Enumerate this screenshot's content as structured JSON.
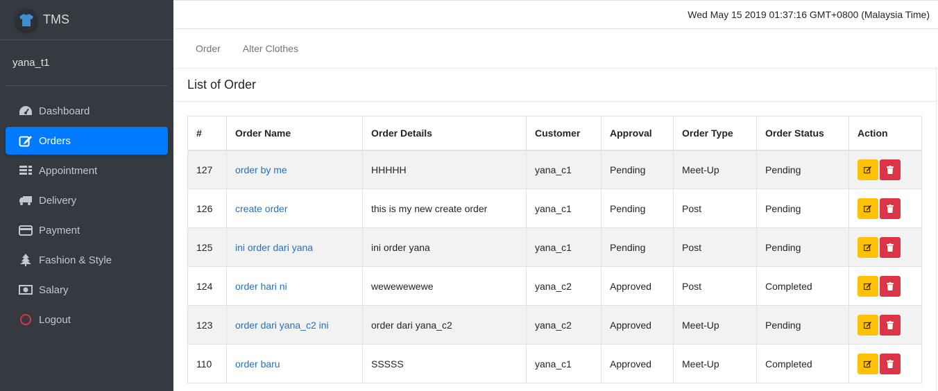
{
  "app": {
    "brand": "TMS",
    "user": "yana_t1"
  },
  "sidebar": {
    "items": [
      {
        "label": "Dashboard",
        "icon": "dashboard-icon",
        "active": false
      },
      {
        "label": "Orders",
        "icon": "edit-icon",
        "active": true
      },
      {
        "label": "Appointment",
        "icon": "appointment-icon",
        "active": false
      },
      {
        "label": "Delivery",
        "icon": "truck-icon",
        "active": false
      },
      {
        "label": "Payment",
        "icon": "credit-card-icon",
        "active": false
      },
      {
        "label": "Fashion & Style",
        "icon": "tree-icon",
        "active": false
      },
      {
        "label": "Salary",
        "icon": "money-icon",
        "active": false
      },
      {
        "label": "Logout",
        "icon": "logout-icon",
        "active": false
      }
    ]
  },
  "topbar": {
    "datetime": "Wed May 15 2019 01:37:16 GMT+0800 (Malaysia Time)"
  },
  "tabs": [
    "Order",
    "Alter Clothes"
  ],
  "card": {
    "title": "List of Order"
  },
  "table": {
    "headers": [
      "#",
      "Order Name",
      "Order Details",
      "Customer",
      "Approval",
      "Order Type",
      "Order Status",
      "Action"
    ],
    "rows": [
      {
        "id": "127",
        "name": "order by me",
        "details": "HHHHH",
        "customer": "yana_c1",
        "approval": "Pending",
        "type": "Meet-Up",
        "status": "Pending"
      },
      {
        "id": "126",
        "name": "create order",
        "details": "this is my new create order",
        "customer": "yana_c1",
        "approval": "Pending",
        "type": "Post",
        "status": "Pending"
      },
      {
        "id": "125",
        "name": "ini order dari yana",
        "details": "ini order yana",
        "customer": "yana_c1",
        "approval": "Pending",
        "type": "Post",
        "status": "Pending"
      },
      {
        "id": "124",
        "name": "order hari ni",
        "details": "wewewewewe",
        "customer": "yana_c2",
        "approval": "Approved",
        "type": "Post",
        "status": "Completed"
      },
      {
        "id": "123",
        "name": "order dari yana_c2 ini",
        "details": "order dari yana_c2",
        "customer": "yana_c2",
        "approval": "Approved",
        "type": "Meet-Up",
        "status": "Pending"
      },
      {
        "id": "110",
        "name": "order baru",
        "details": "SSSSS",
        "customer": "yana_c1",
        "approval": "Approved",
        "type": "Meet-Up",
        "status": "Completed"
      }
    ]
  },
  "colors": {
    "sidebar_bg": "#343a40",
    "active": "#007bff",
    "edit": "#ffc107",
    "delete": "#dc3545",
    "link": "#1a73c8",
    "logout": "#dc3545"
  }
}
